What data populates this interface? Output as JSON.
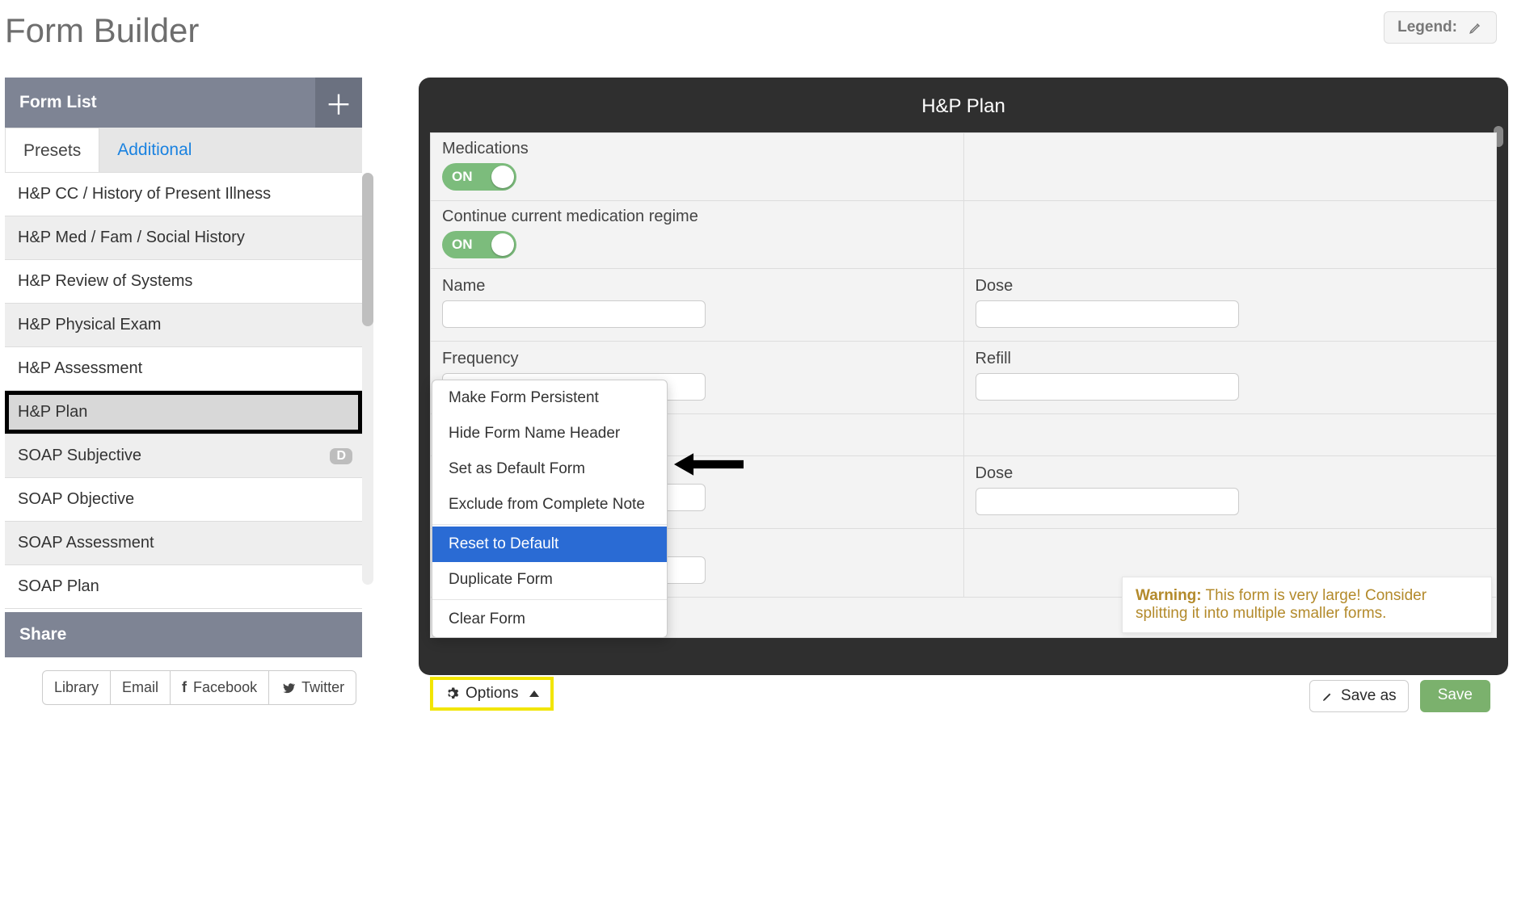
{
  "page_title": "Form Builder",
  "legend_label": "Legend:",
  "sidebar": {
    "header": "Form List",
    "tabs": {
      "presets": "Presets",
      "additional": "Additional"
    },
    "items": [
      {
        "label": "H&P CC / History of Present Illness"
      },
      {
        "label": "H&P Med / Fam / Social History"
      },
      {
        "label": "H&P Review of Systems"
      },
      {
        "label": "H&P Physical Exam"
      },
      {
        "label": "H&P Assessment"
      },
      {
        "label": "H&P Plan",
        "selected": true
      },
      {
        "label": "SOAP Subjective",
        "badge": "D"
      },
      {
        "label": "SOAP Objective"
      },
      {
        "label": "SOAP Assessment"
      },
      {
        "label": "SOAP Plan"
      }
    ],
    "share_header": "Share",
    "share": {
      "library": "Library",
      "email": "Email",
      "facebook": "Facebook",
      "twitter": "Twitter"
    }
  },
  "canvas": {
    "title": "H&P Plan",
    "fields": {
      "medications": "Medications",
      "continue": "Continue current medication regime",
      "name": "Name",
      "dose": "Dose",
      "frequency": "Frequency",
      "refill": "Refill",
      "dose2": "Dose",
      "toggle_on": "ON"
    }
  },
  "options_btn": "Options",
  "options_menu": [
    "Make Form Persistent",
    "Hide Form Name Header",
    "Set as Default Form",
    "Exclude from Complete Note",
    "Reset to Default",
    "Duplicate Form",
    "Clear Form"
  ],
  "warning": {
    "strong": "Warning:",
    "text": " This form is very large! Consider splitting it into multiple smaller forms."
  },
  "footer": {
    "save_as": "Save as",
    "save": "Save"
  }
}
